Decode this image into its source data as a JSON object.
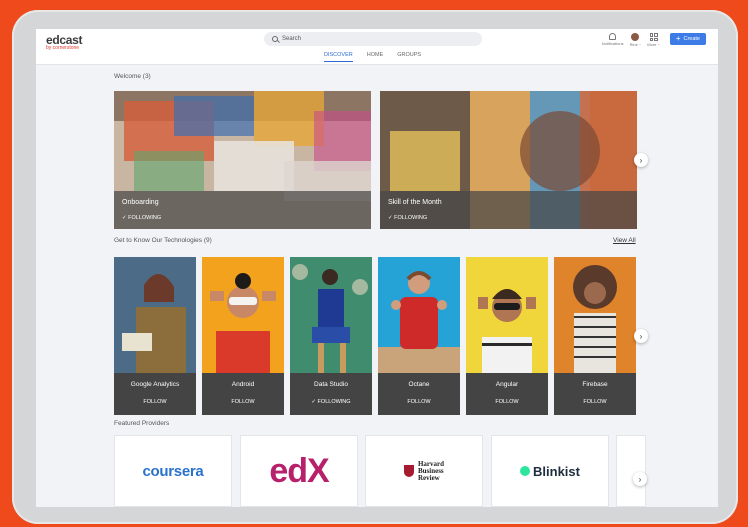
{
  "app": {
    "logo_main": "edcast",
    "logo_sub": "by cornerstone"
  },
  "header": {
    "search_placeholder": "Search",
    "tabs": [
      "DISCOVER",
      "HOME",
      "GROUPS"
    ],
    "nav": {
      "notifications": "Notifications",
      "user": "Rine ~",
      "more": "More ~",
      "create": "Create"
    }
  },
  "welcome": {
    "title": "Welcome (3)",
    "cards": [
      {
        "name": "Onboarding",
        "status": "✓ FOLLOWING"
      },
      {
        "name": "Skill of the Month",
        "status": "✓ FOLLOWING"
      }
    ]
  },
  "technologies": {
    "title": "Get to Know Our Technologies (9)",
    "view_all": "View All",
    "cards": [
      {
        "name": "Google Analytics",
        "status": "FOLLOW"
      },
      {
        "name": "Android",
        "status": "FOLLOW"
      },
      {
        "name": "Data Studio",
        "status": "✓ FOLLOWING"
      },
      {
        "name": "Octane",
        "status": "FOLLOW"
      },
      {
        "name": "Angular",
        "status": "FOLLOW"
      },
      {
        "name": "Firebase",
        "status": "FOLLOW"
      }
    ]
  },
  "providers": {
    "title": "Featured Providers",
    "items": [
      "coursera",
      "edX",
      "Harvard Business Review",
      "Blinkist"
    ],
    "hbr_lines": [
      "Harvard",
      "Business",
      "Review"
    ]
  },
  "colors": {
    "background": "#ee4a1c",
    "accent": "#3d7be6",
    "active_tab": "#2e6dd6",
    "coursera": "#2a73cc",
    "edx_pink": "#b7206b",
    "edx_blue": "#0d9ed9",
    "blinkist": "#1f2d3d",
    "blinkist_green": "#2ee59d",
    "hbr_red": "#a51c30"
  },
  "icons": {
    "search": "search-icon",
    "notifications": "bell-icon",
    "more": "grid-icon",
    "create": "plus-icon",
    "carousel_next": "chevron-right-icon",
    "following_check": "check-icon"
  }
}
